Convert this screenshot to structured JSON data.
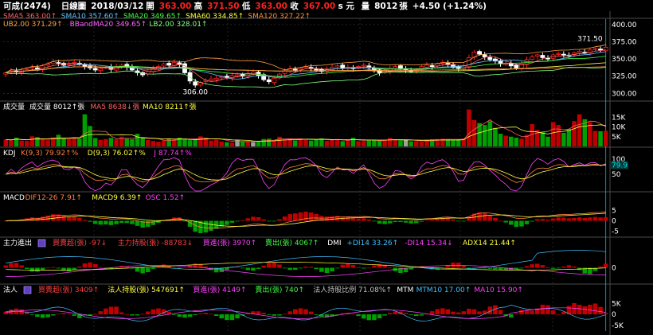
{
  "header": {
    "stock": "可成(2474)",
    "period": "日線圖",
    "date": "2018/03/12",
    "open_label": "開",
    "open": "363.00",
    "high_label": "高",
    "high": "371.50",
    "low_label": "低",
    "low": "363.00",
    "close_label": "收",
    "close": "367.00",
    "close_unit": "s 元",
    "volume_label": "量",
    "volume": "8012",
    "volume_unit": "張",
    "change": "+4.50 (+1.24%)"
  },
  "colors": {
    "up": "#ff2020",
    "down": "#00d000",
    "bar_up": "#c00000",
    "bar_down": "#00a000",
    "neutral": "#a0a0a0",
    "grid": "#3a3a3a",
    "cursor": "#00c0c0"
  },
  "chart_data": [
    {
      "type": "candlestick",
      "panel": "price",
      "ma_legend_1": [
        {
          "name": "SMA5",
          "value": "363.00↑",
          "color": "#ff6060"
        },
        {
          "name": "SMA10",
          "value": "357.60↑",
          "color": "#60c0ff"
        },
        {
          "name": "SMA20",
          "value": "349.65↑",
          "color": "#40ff40"
        },
        {
          "name": "SMA60",
          "value": "334.85↑",
          "color": "#ffff40"
        },
        {
          "name": "SMA120",
          "value": "327.22↑",
          "color": "#ff9040"
        }
      ],
      "ma_legend_2": [
        {
          "name": "UB2.00",
          "value": "371.29↑",
          "color": "#ffa040"
        },
        {
          "name": "BBandMA20",
          "value": "349.65↑",
          "color": "#ff60ff"
        },
        {
          "name": "LB2.00",
          "value": "328.01↑",
          "color": "#80ff80"
        }
      ],
      "y_ticks": [
        "400.00",
        "375.00",
        "350.00",
        "325.00",
        "300.00"
      ],
      "ylim": [
        290,
        408
      ],
      "annotations": {
        "high_label": "371.50",
        "low_label": "306.00"
      },
      "closes": [
        330,
        333,
        331,
        334,
        336,
        338,
        335,
        340,
        343,
        346,
        344,
        341,
        343,
        345,
        342,
        339,
        337,
        334,
        336,
        338,
        335,
        339,
        341,
        338,
        334,
        330,
        327,
        332,
        336,
        339,
        343,
        341,
        345,
        342,
        330,
        318,
        312,
        316,
        319,
        321,
        322,
        324,
        323,
        326,
        327,
        325,
        329,
        331,
        326,
        320,
        317,
        322,
        328,
        333,
        336,
        334,
        337,
        339,
        336,
        334,
        332,
        335,
        338,
        340,
        337,
        338,
        336,
        339,
        341,
        337,
        333,
        330,
        333,
        336,
        339,
        336,
        334,
        332,
        335,
        339,
        341,
        339,
        343,
        345,
        342,
        338,
        336,
        340,
        352,
        360,
        357,
        353,
        349,
        347,
        343,
        344,
        340,
        337,
        343,
        349,
        353,
        356,
        352,
        350,
        356,
        358,
        356,
        355,
        359,
        361,
        359,
        363,
        365,
        363,
        367
      ]
    },
    {
      "type": "bar",
      "panel": "volume",
      "title": "成交量",
      "legend": [
        {
          "name": "成交量",
          "value": "8012↑張",
          "color": "#ffffff"
        },
        {
          "name": "MA5",
          "value": "8638↓張",
          "color": "#ff6060"
        },
        {
          "name": "MA10",
          "value": "8211↑張",
          "color": "#ffff40"
        }
      ],
      "y_ticks": [
        "15K",
        "10K",
        "5K"
      ],
      "ylim": [
        0,
        18000
      ],
      "values": [
        3500,
        3200,
        4500,
        3000,
        2800,
        5200,
        4800,
        3600,
        3200,
        4600,
        6000,
        4200,
        3800,
        4400,
        4000,
        16500,
        10500,
        4300,
        3400,
        3800,
        4400,
        3700,
        5000,
        3900,
        3700,
        6500,
        4500,
        3300,
        2800,
        2400,
        3100,
        4000,
        3600,
        4500,
        3900,
        3200,
        3800,
        5200,
        4500,
        3000,
        3400,
        2500,
        2200,
        2000,
        3300,
        2500,
        2600,
        2200,
        2900,
        3800,
        4000,
        3300,
        5000,
        3600,
        4000,
        3100,
        3900,
        3600,
        3000,
        3500,
        4100,
        2900,
        3300,
        3800,
        2700,
        3300,
        4500,
        2700,
        2800,
        3100,
        3500,
        2900,
        3300,
        4400,
        3500,
        3200,
        3400,
        2600,
        2700,
        2400,
        3500,
        3600,
        3800,
        4000,
        3500,
        3100,
        3700,
        4000,
        19000,
        13500,
        12000,
        11000,
        13000,
        9500,
        6500,
        5500,
        5000,
        4500,
        4000,
        6000,
        11500,
        8500,
        7500,
        5000,
        12500,
        11000,
        7000,
        9000,
        13000,
        16500,
        14000,
        12500,
        8000,
        7800,
        8012
      ]
    },
    {
      "type": "line",
      "panel": "kdj",
      "title": "KDJ",
      "legend": [
        {
          "name": "K(9,3)",
          "value": "79.92↑%",
          "color": "#ff8040"
        },
        {
          "name": "D(9,3)",
          "value": "76.02↑%",
          "color": "#ffff40"
        },
        {
          "name": "J",
          "value": "87.74↑%",
          "color": "#ff40ff"
        }
      ],
      "y_ticks": [
        "100",
        "50"
      ],
      "current_label": "79.9",
      "ylim": [
        -5,
        110
      ]
    },
    {
      "type": "bar",
      "panel": "macd",
      "title": "MACD",
      "legend": [
        {
          "name": "DIF12-26",
          "value": "7.91↑",
          "color": "#ff8040"
        },
        {
          "name": "MACD9",
          "value": "6.39↑",
          "color": "#ffff40"
        },
        {
          "name": "OSC",
          "value": "1.52↑",
          "color": "#ff40ff"
        }
      ],
      "y_ticks": [
        "5",
        "0",
        "-5"
      ],
      "ylim": [
        -8,
        8
      ]
    },
    {
      "type": "bar",
      "panel": "main-force",
      "title": "主力進出",
      "legend": [
        {
          "name": "買賣超(張)",
          "value": "-97↓",
          "color": "#ff4040"
        },
        {
          "name": "主力持股(張)",
          "value": "-88783↓",
          "color": "#ff4040"
        },
        {
          "name": "買進(張)",
          "value": "3970↑",
          "color": "#ff40ff"
        },
        {
          "name": "賣出(張)",
          "value": "4067↑",
          "color": "#40ff40"
        },
        {
          "name": "DMI",
          "value": "",
          "color": "#ffffff"
        },
        {
          "name": "+DI14",
          "value": "33.26↑",
          "color": "#40c0ff"
        },
        {
          "name": "-DI14",
          "value": "15.34↓",
          "color": "#ff40ff"
        },
        {
          "name": "ADX14",
          "value": "21.44↑",
          "color": "#ffff40"
        }
      ],
      "y_ticks": [
        "0"
      ],
      "ylim": [
        -10,
        10
      ]
    },
    {
      "type": "bar",
      "panel": "institutional",
      "title": "法人",
      "legend": [
        {
          "name": "買賣超(張)",
          "value": "3409↑",
          "color": "#ff4040"
        },
        {
          "name": "法人持股(張)",
          "value": "547691↑",
          "color": "#ffff40"
        },
        {
          "name": "買進(張)",
          "value": "4149↑",
          "color": "#ff40ff"
        },
        {
          "name": "賣出(張)",
          "value": "740↑",
          "color": "#40ff40"
        },
        {
          "name": "法人持股比例",
          "value": "71.08%↑",
          "color": "#c0c0c0"
        },
        {
          "name": "MTM",
          "value": "",
          "color": "#ffffff"
        },
        {
          "name": "MTM10",
          "value": "17.00↑",
          "color": "#40c0ff"
        },
        {
          "name": "MA10",
          "value": "15.90↑",
          "color": "#ff40ff"
        }
      ],
      "y_ticks": [
        "5K",
        "0",
        "-5K"
      ],
      "ylim": [
        -8,
        8
      ]
    }
  ]
}
